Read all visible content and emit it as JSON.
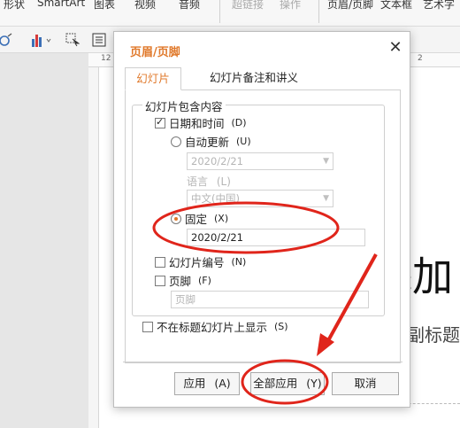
{
  "ribbon": {
    "tabs": [
      "形状",
      "SmartArt",
      "图表",
      "视频",
      "音频",
      "超链接",
      "操作",
      "页眉/页脚",
      "文本框",
      "艺术字"
    ]
  },
  "ruler": {
    "left_num": "12",
    "right_num": "2"
  },
  "slide": {
    "title_fragment": "添加",
    "subtitle_fragment": "副标题"
  },
  "dialog": {
    "title": "页眉/页脚",
    "close_glyph": "✕",
    "tabs": [
      "幻灯片",
      "幻灯片备注和讲义"
    ],
    "group_label": "幻灯片包含内容",
    "date_time": {
      "label": "日期和时间",
      "hotkey": "(D)",
      "checked": true
    },
    "auto_update": {
      "label": "自动更新",
      "hotkey": "(U)"
    },
    "auto_date_value": "2020/2/21",
    "language_label": "语言",
    "language_hotkey": "(L)",
    "language_value": "中文(中国)",
    "fixed": {
      "label": "固定",
      "hotkey": "(X)",
      "selected": true
    },
    "fixed_value": "2020/2/21",
    "slide_number": {
      "label": "幻灯片编号",
      "hotkey": "(N)",
      "checked": false
    },
    "footer": {
      "label": "页脚",
      "hotkey": "(F)",
      "checked": false
    },
    "footer_value": "页脚",
    "hide_on_title": {
      "label": "不在标题幻灯片上显示",
      "hotkey": "(S)",
      "checked": false
    },
    "buttons": {
      "apply": "应用",
      "apply_hotkey": "(A)",
      "apply_all": "全部应用",
      "apply_all_hotkey": "(Y)",
      "cancel": "取消"
    }
  },
  "colors": {
    "accent": "#e0792b",
    "annotation_red": "#e0251b"
  }
}
